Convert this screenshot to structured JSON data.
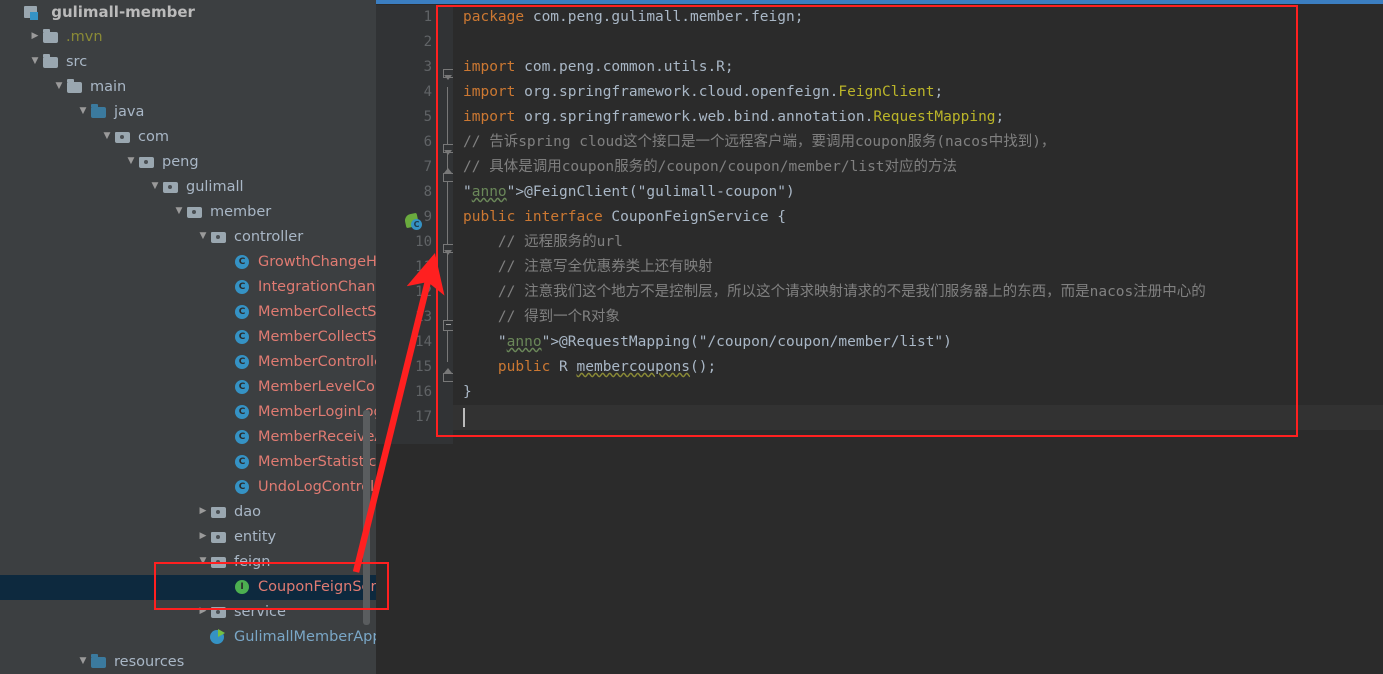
{
  "project": {
    "module_name": "gulimall-member",
    "tree": [
      {
        "label": ".mvn",
        "indent": 1,
        "arrow": "closed",
        "icon": "folder-icon",
        "style": "mvn"
      },
      {
        "label": "src",
        "indent": 1,
        "arrow": "open",
        "icon": "folder-icon",
        "style": "plain"
      },
      {
        "label": "main",
        "indent": 2,
        "arrow": "open",
        "icon": "folder-icon",
        "style": "plain"
      },
      {
        "label": "java",
        "indent": 3,
        "arrow": "open",
        "icon": "source-folder-icon",
        "style": "plain"
      },
      {
        "label": "com",
        "indent": 4,
        "arrow": "open",
        "icon": "package-icon",
        "style": "plain"
      },
      {
        "label": "peng",
        "indent": 5,
        "arrow": "open",
        "icon": "package-icon",
        "style": "plain"
      },
      {
        "label": "gulimall",
        "indent": 6,
        "arrow": "open",
        "icon": "package-icon",
        "style": "plain"
      },
      {
        "label": "member",
        "indent": 7,
        "arrow": "open",
        "icon": "package-icon",
        "style": "plain"
      },
      {
        "label": "controller",
        "indent": 8,
        "arrow": "open",
        "icon": "package-icon",
        "style": "plain"
      },
      {
        "label": "GrowthChangeHistoryController",
        "indent": 9,
        "arrow": "none",
        "icon": "java-class-icon",
        "style": "cls"
      },
      {
        "label": "IntegrationChangeHistoryController",
        "indent": 9,
        "arrow": "none",
        "icon": "java-class-icon",
        "style": "cls"
      },
      {
        "label": "MemberCollectSpuController",
        "indent": 9,
        "arrow": "none",
        "icon": "java-class-icon",
        "style": "cls"
      },
      {
        "label": "MemberCollectSubjectController",
        "indent": 9,
        "arrow": "none",
        "icon": "java-class-icon",
        "style": "cls"
      },
      {
        "label": "MemberController",
        "indent": 9,
        "arrow": "none",
        "icon": "java-class-icon",
        "style": "cls"
      },
      {
        "label": "MemberLevelController",
        "indent": 9,
        "arrow": "none",
        "icon": "java-class-icon",
        "style": "cls"
      },
      {
        "label": "MemberLoginLogController",
        "indent": 9,
        "arrow": "none",
        "icon": "java-class-icon",
        "style": "cls"
      },
      {
        "label": "MemberReceiveAddressController",
        "indent": 9,
        "arrow": "none",
        "icon": "java-class-icon",
        "style": "cls"
      },
      {
        "label": "MemberStatisticsInfoController",
        "indent": 9,
        "arrow": "none",
        "icon": "java-class-icon",
        "style": "cls"
      },
      {
        "label": "UndoLogController",
        "indent": 9,
        "arrow": "none",
        "icon": "java-class-icon",
        "style": "cls"
      },
      {
        "label": "dao",
        "indent": 8,
        "arrow": "closed",
        "icon": "package-icon",
        "style": "plain"
      },
      {
        "label": "entity",
        "indent": 8,
        "arrow": "closed",
        "icon": "package-icon",
        "style": "plain"
      },
      {
        "label": "feign",
        "indent": 8,
        "arrow": "open",
        "icon": "package-icon",
        "style": "plain"
      },
      {
        "label": "CouponFeignService",
        "indent": 9,
        "arrow": "none",
        "icon": "java-interface-icon",
        "style": "cls",
        "selected": true
      },
      {
        "label": "service",
        "indent": 8,
        "arrow": "closed",
        "icon": "package-icon",
        "style": "plain"
      },
      {
        "label": "GulimallMemberApplication",
        "indent": 8,
        "arrow": "none",
        "icon": "spring-boot-app-icon",
        "style": "app"
      },
      {
        "label": "resources",
        "indent": 3,
        "arrow": "open",
        "icon": "source-folder-icon",
        "style": "plain"
      }
    ]
  },
  "editor": {
    "file_caret_line": 17,
    "lines": [
      {
        "n": 1,
        "text": "package com.peng.gulimall.member.feign;"
      },
      {
        "n": 2,
        "text": ""
      },
      {
        "n": 3,
        "text": "import com.peng.common.utils.R;"
      },
      {
        "n": 4,
        "text": "import org.springframework.cloud.openfeign.FeignClient;"
      },
      {
        "n": 5,
        "text": "import org.springframework.web.bind.annotation.RequestMapping;"
      },
      {
        "n": 6,
        "text": "// 告诉spring cloud这个接口是一个远程客户端，要调用coupon服务(nacos中找到)，"
      },
      {
        "n": 7,
        "text": "// 具体是调用coupon服务的/coupon/coupon/member/list对应的方法"
      },
      {
        "n": 8,
        "text": "@FeignClient(\"gulimall-coupon\")"
      },
      {
        "n": 9,
        "text": "public interface CouponFeignService {"
      },
      {
        "n": 10,
        "text": "    // 远程服务的url"
      },
      {
        "n": 11,
        "text": "    // 注意写全优惠券类上还有映射"
      },
      {
        "n": 12,
        "text": "    // 注意我们这个地方不是控制层，所以这个请求映射请求的不是我们服务器上的东西，而是nacos注册中心的"
      },
      {
        "n": 13,
        "text": "    // 得到一个R对象"
      },
      {
        "n": 14,
        "text": "    @RequestMapping(\"/coupon/coupon/member/list\")"
      },
      {
        "n": 15,
        "text": "    public R membercoupons();"
      },
      {
        "n": 16,
        "text": "}"
      },
      {
        "n": 17,
        "text": ""
      }
    ],
    "gutter_icons": [
      {
        "line": 9,
        "icon": "spring-bean-icon"
      }
    ]
  },
  "annotations": {
    "colors": {
      "highlight_red": "#ff2020",
      "selection_blue": "#0d293e",
      "progress_blue": "#3b7ec1"
    },
    "boxes": [
      {
        "name": "code-highlight-box"
      },
      {
        "name": "tree-feign-highlight-box"
      }
    ],
    "arrow": {
      "name": "pointer-arrow",
      "color": "#ff2020"
    }
  }
}
